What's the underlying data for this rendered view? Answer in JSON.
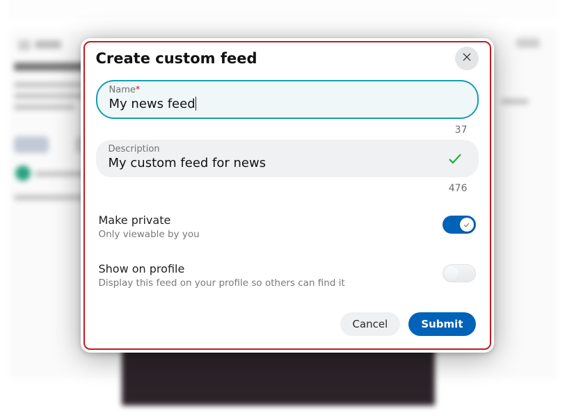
{
  "modal": {
    "title": "Create custom feed",
    "name_field": {
      "label": "Name",
      "required_marker": "*",
      "value": "My news feed",
      "remaining": "37"
    },
    "description_field": {
      "label": "Description",
      "value": "My custom feed for news",
      "remaining": "476"
    },
    "private_toggle": {
      "title": "Make private",
      "subtitle": "Only viewable by you",
      "on": true
    },
    "profile_toggle": {
      "title": "Show on profile",
      "subtitle": "Display this feed on your profile so others can find it",
      "on": false
    },
    "actions": {
      "cancel": "Cancel",
      "submit": "Submit"
    }
  }
}
